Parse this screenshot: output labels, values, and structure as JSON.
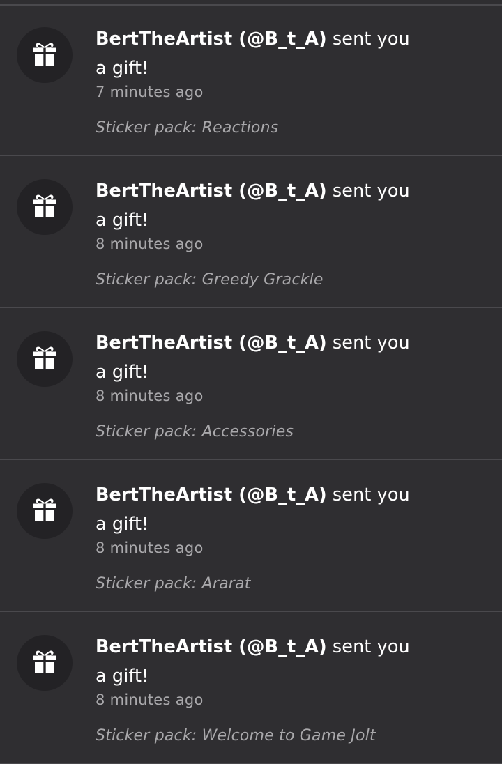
{
  "notifications": [
    {
      "user": "BertTheArtist (@B_t_A)",
      "action_line1": " sent you",
      "action_line2": "a gift!",
      "time": "7 minutes ago",
      "detail": "Sticker pack: Reactions",
      "icon": "gift-icon"
    },
    {
      "user": "BertTheArtist (@B_t_A)",
      "action_line1": " sent you",
      "action_line2": "a gift!",
      "time": "8 minutes ago",
      "detail": "Sticker pack: Greedy Grackle",
      "icon": "gift-icon"
    },
    {
      "user": "BertTheArtist (@B_t_A)",
      "action_line1": " sent you",
      "action_line2": "a gift!",
      "time": "8 minutes ago",
      "detail": "Sticker pack: Accessories",
      "icon": "gift-icon"
    },
    {
      "user": "BertTheArtist (@B_t_A)",
      "action_line1": " sent you",
      "action_line2": "a gift!",
      "time": "8 minutes ago",
      "detail": "Sticker pack: Ararat",
      "icon": "gift-icon"
    },
    {
      "user": "BertTheArtist (@B_t_A)",
      "action_line1": " sent you",
      "action_line2": "a gift!",
      "time": "8 minutes ago",
      "detail": "Sticker pack: Welcome to Game Jolt",
      "icon": "gift-icon"
    }
  ],
  "colors": {
    "background": "#2f2e31",
    "divider": "#4a494d",
    "avatar_bg": "#232225",
    "primary_text": "#ffffff",
    "secondary_text": "#a9a8ab"
  }
}
